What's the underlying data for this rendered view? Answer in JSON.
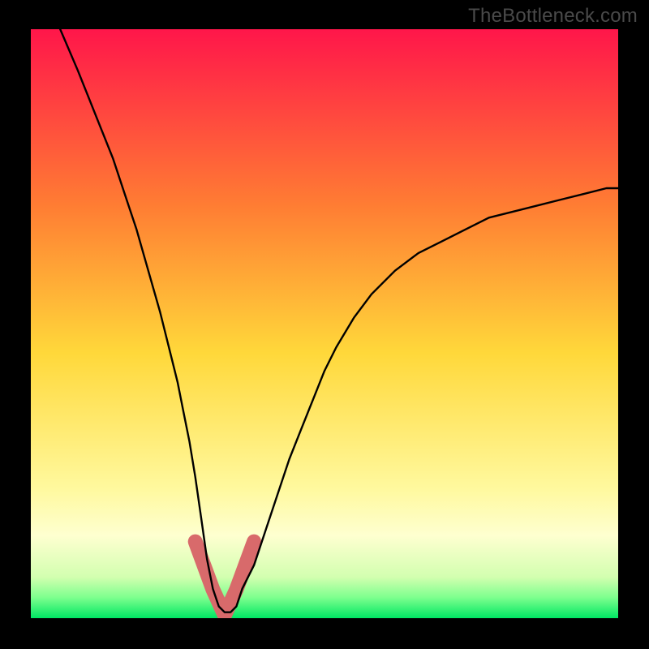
{
  "watermark": "TheBottleneck.com",
  "colors": {
    "frame_bg": "#000000",
    "gradient_top": "#ff164a",
    "gradient_mid_upper": "#ff8b2e",
    "gradient_mid": "#ffe334",
    "gradient_lower": "#f7ff9e",
    "gradient_band": "#feffd0",
    "gradient_bottom": "#00e763",
    "curve": "#000000",
    "highlight": "#d86a6b"
  },
  "chart_data": {
    "type": "line",
    "title": "",
    "xlabel": "",
    "ylabel": "",
    "xlim": [
      0,
      100
    ],
    "ylim": [
      0,
      100
    ],
    "grid": false,
    "legend_position": "none",
    "series": [
      {
        "name": "bottleneck-curve",
        "x": [
          5,
          8,
          10,
          12,
          14,
          16,
          18,
          20,
          22,
          24,
          25,
          26,
          27,
          28,
          29,
          30,
          31,
          32,
          33,
          34,
          35,
          36,
          38,
          40,
          42,
          44,
          46,
          48,
          50,
          52,
          55,
          58,
          62,
          66,
          70,
          74,
          78,
          82,
          86,
          90,
          94,
          98,
          100
        ],
        "y": [
          100,
          93,
          88,
          83,
          78,
          72,
          66,
          59,
          52,
          44,
          40,
          35,
          30,
          24,
          17,
          10,
          5,
          2,
          1,
          1,
          2,
          5,
          9,
          15,
          21,
          27,
          32,
          37,
          42,
          46,
          51,
          55,
          59,
          62,
          64,
          66,
          68,
          69,
          70,
          71,
          72,
          73,
          73
        ]
      }
    ],
    "annotations": [
      {
        "name": "valley-highlight",
        "shape": "u-band",
        "x_range": [
          28,
          38
        ],
        "y_min": 0.5,
        "y_peak": 13,
        "stroke_width_px": 18,
        "color": "#d86a6b"
      }
    ],
    "background_gradient_stops": [
      {
        "offset": 0.0,
        "color": "#ff164a"
      },
      {
        "offset": 0.3,
        "color": "#ff7d33"
      },
      {
        "offset": 0.55,
        "color": "#ffd83a"
      },
      {
        "offset": 0.78,
        "color": "#fff99e"
      },
      {
        "offset": 0.86,
        "color": "#feffd0"
      },
      {
        "offset": 0.93,
        "color": "#d3ffb0"
      },
      {
        "offset": 0.965,
        "color": "#7dff8e"
      },
      {
        "offset": 1.0,
        "color": "#00e763"
      }
    ]
  }
}
